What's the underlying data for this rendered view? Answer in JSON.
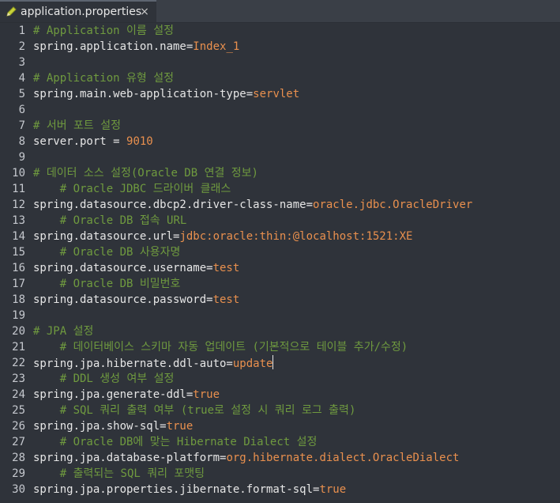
{
  "tab": {
    "title": "application.properties",
    "icon": "pencil-icon",
    "close_glyph": "×"
  },
  "lines": [
    {
      "n": "1",
      "type": "comment",
      "text": "# Application 이름 설정"
    },
    {
      "n": "2",
      "type": "kv",
      "key": "spring.application.name=",
      "value": "Index_1"
    },
    {
      "n": "3",
      "type": "blank"
    },
    {
      "n": "4",
      "type": "comment",
      "text": "# Application 유형 설정"
    },
    {
      "n": "5",
      "type": "kv",
      "key": "spring.main.web-application-type=",
      "value": "servlet"
    },
    {
      "n": "6",
      "type": "blank"
    },
    {
      "n": "7",
      "type": "comment",
      "text": "# 서버 포트 설정"
    },
    {
      "n": "8",
      "type": "kv",
      "key": "server.port = ",
      "value": "9010"
    },
    {
      "n": "9",
      "type": "blank"
    },
    {
      "n": "10",
      "type": "comment",
      "text": "# 데이터 소스 설정(Oracle DB 연결 정보)"
    },
    {
      "n": "11",
      "type": "comment",
      "text": "    # Oracle JDBC 드라이버 클래스"
    },
    {
      "n": "12",
      "type": "kv",
      "key": "spring.datasource.dbcp2.driver-class-name=",
      "value": "oracle.jdbc.OracleDriver"
    },
    {
      "n": "13",
      "type": "comment",
      "text": "    # Oracle DB 접속 URL"
    },
    {
      "n": "14",
      "type": "kv",
      "key": "spring.datasource.url=",
      "value": "jdbc:oracle:thin:@localhost:1521:XE"
    },
    {
      "n": "15",
      "type": "comment",
      "text": "    # Oracle DB 사용자명"
    },
    {
      "n": "16",
      "type": "kv",
      "key": "spring.datasource.username=",
      "value": "test"
    },
    {
      "n": "17",
      "type": "comment",
      "text": "    # Oracle DB 비밀번호"
    },
    {
      "n": "18",
      "type": "kv",
      "key": "spring.datasource.password=",
      "value": "test"
    },
    {
      "n": "19",
      "type": "blank"
    },
    {
      "n": "20",
      "type": "comment",
      "text": "# JPA 설정"
    },
    {
      "n": "21",
      "type": "comment",
      "text": "    # 데이터베이스 스키마 자동 업데이트 (기본적으로 테이블 추가/수정)"
    },
    {
      "n": "22",
      "type": "kv",
      "key": "spring.jpa.hibernate.ddl-auto=",
      "value": "update",
      "caret": true
    },
    {
      "n": "23",
      "type": "comment",
      "text": "    # DDL 생성 여부 설정"
    },
    {
      "n": "24",
      "type": "kv",
      "key": "spring.jpa.generate-ddl=",
      "value": "true"
    },
    {
      "n": "25",
      "type": "comment",
      "text": "    # SQL 쿼리 출력 여부 (true로 설정 시 쿼리 로그 출력)"
    },
    {
      "n": "26",
      "type": "kv",
      "key": "spring.jpa.show-sql=",
      "value": "true"
    },
    {
      "n": "27",
      "type": "comment",
      "text": "    # Oracle DB에 맞는 Hibernate Dialect 설정"
    },
    {
      "n": "28",
      "type": "kv",
      "key": "spring.jpa.database-platform=",
      "value": "org.hibernate.dialect.OracleDialect"
    },
    {
      "n": "29",
      "type": "comment",
      "text": "    # 출력되는 SQL 쿼리 포맷팅"
    },
    {
      "n": "30",
      "type": "kv",
      "key": "spring.jpa.properties.jibernate.format-sql=",
      "value": "true"
    }
  ],
  "colors": {
    "background": "#2f333a",
    "key": "#e6e6e6",
    "value": "#e9904e",
    "comment": "#6f9a3f",
    "line_number": "#c5c8ce"
  }
}
